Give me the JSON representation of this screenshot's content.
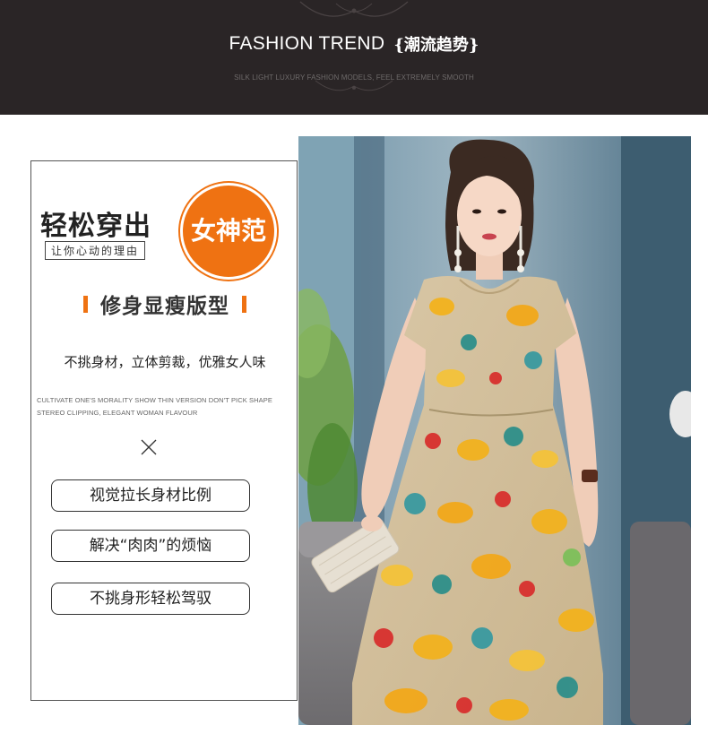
{
  "header": {
    "title_en": "FASHION TREND",
    "title_cn": "{潮流趋势}",
    "subtitle": "SILK LIGHT LUXURY FASHION MODELS, FEEL EXTREMELY SMOOTH"
  },
  "card": {
    "headline": "轻松穿出",
    "badge": "女神范",
    "tagline": "让你心动的理由",
    "feature_title": "修身显瘦版型",
    "description_cn": "不挑身材，立体剪裁，优雅女人味",
    "description_en": "CULTIVATE ONE'S MORALITY SHOW THIN VERSION DON'T PICK SHAPE STEREO CLIPPING, ELEGANT WOMAN FLAVOUR",
    "features": [
      "视觉拉长身材比例",
      "解决“肉肉”的烦恼",
      "不挑身形轻松驾驭"
    ]
  },
  "colors": {
    "header_bg": "#2a2526",
    "accent": "#ef7212",
    "dress_yellow": "#f2b21e",
    "dress_beige": "#d9c7a6"
  }
}
